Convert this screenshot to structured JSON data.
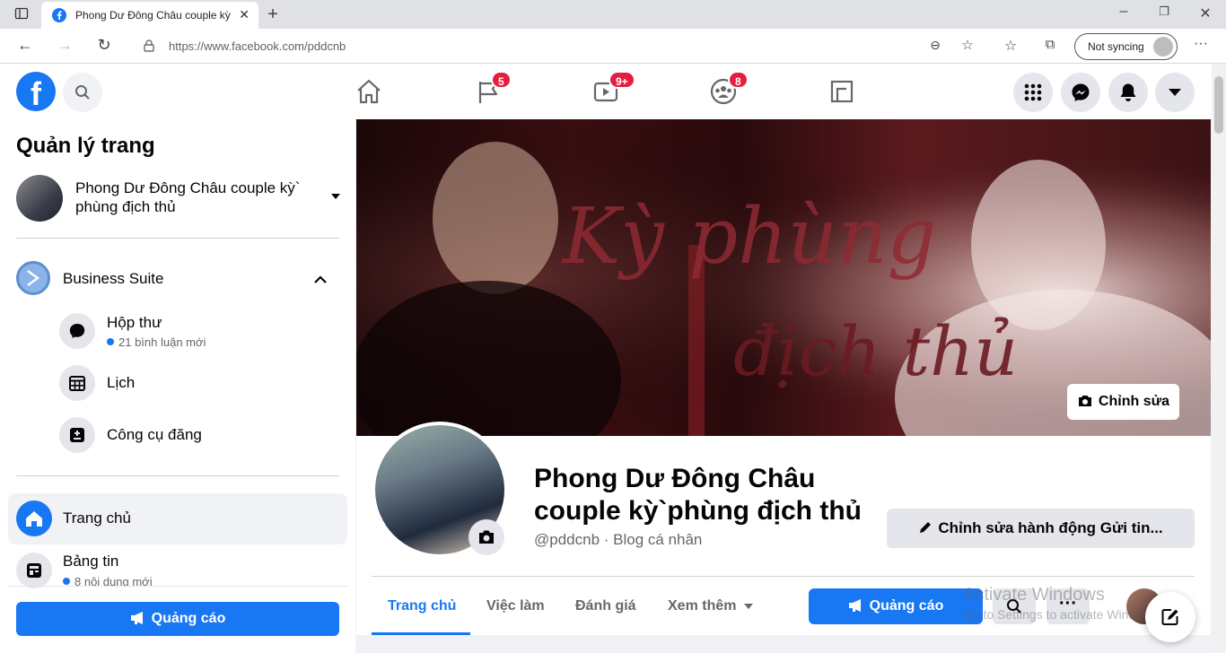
{
  "browser": {
    "tab_title": "Phong Dư Đông Châu couple kỳ",
    "url": "https://www.facebook.com/pddcnb",
    "sync_label": "Not syncing"
  },
  "fb_nav": {
    "logo_letter": "f",
    "badges": {
      "pages": "5",
      "watch": "9+",
      "groups": "8"
    }
  },
  "sidebar": {
    "title": "Quản lý trang",
    "page_name": "Phong Dư Đông Châu couple kỳ` phùng địch thủ",
    "business_suite": "Business Suite",
    "inbox_label": "Hộp thư",
    "inbox_meta": "21 bình luận mới",
    "calendar_label": "Lịch",
    "publish_label": "Công cụ đăng",
    "home_label": "Trang chủ",
    "news_label": "Bảng tin",
    "news_meta": "8 nội dung mới",
    "ad_button": "Quảng cáo"
  },
  "cover": {
    "script_text_1": "Kỳ phùng",
    "script_text_2": "địch thủ",
    "edit_label": "Chỉnh sửa"
  },
  "profile": {
    "name": "Phong Dư Đông Châu couple kỳ`phùng địch thủ",
    "handle": "@pddcnb · Blog cá nhân",
    "edit_action": "Chỉnh sửa hành động Gửi tin..."
  },
  "page_tabs": {
    "home": "Trang chủ",
    "jobs": "Việc làm",
    "reviews": "Đánh giá",
    "more": "Xem thêm",
    "ad_button": "Quảng cáo",
    "more_dots": "···"
  },
  "watermark": {
    "line1": "Activate Windows",
    "line2": "Go to Settings to activate Windows."
  }
}
